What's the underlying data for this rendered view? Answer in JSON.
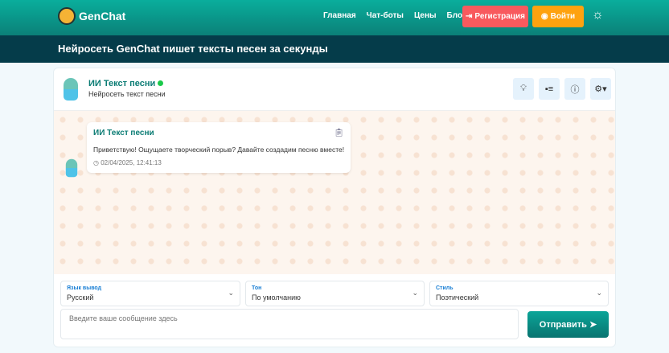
{
  "header": {
    "brand": "GenChat",
    "nav": [
      "Главная",
      "Чат-боты",
      "Цены",
      "Блог"
    ],
    "register": "Регистрация",
    "login": "Войти"
  },
  "banner": {
    "title": "Нейросеть GenChat пишет тексты песен за секунды"
  },
  "bot": {
    "name": "ИИ Текст песни",
    "subtitle": "Нейросеть текст песни"
  },
  "message": {
    "author": "ИИ Текст песни",
    "text": "Приветствую! Ощущаете творческий порыв? Давайте создадим песню вместе!",
    "timestamp": "02/04/2025, 12:41:13"
  },
  "controls": {
    "selects": [
      {
        "label": "Язык вывод",
        "value": "Русский"
      },
      {
        "label": "Тон",
        "value": "По умолчанию"
      },
      {
        "label": "Стиль",
        "value": "Поэтический"
      }
    ],
    "placeholder": "Введите ваше сообщение здесь",
    "send": "Отправить"
  }
}
